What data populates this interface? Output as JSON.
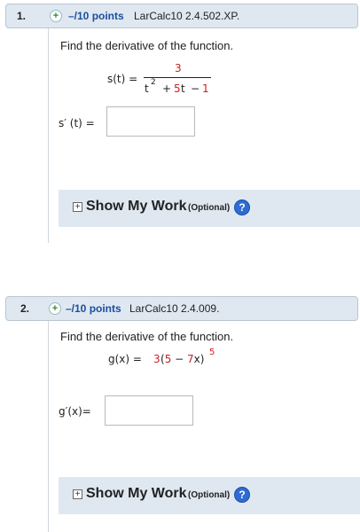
{
  "questions": [
    {
      "number": "1.",
      "points": "–/10 points",
      "source": "LarCalc10 2.4.502.XP.",
      "prompt": "Find the derivative of the function.",
      "func_lhs": "s(t) =",
      "numerator": "3",
      "den_t": "t",
      "den_exp": "2",
      "den_plus1": "+",
      "den_5t": "5t",
      "den_minus": "−",
      "den_1": "1",
      "answer_label": "s′ (t) =",
      "answer_value": "",
      "show_work": "Show My Work",
      "optional": "(Optional)",
      "help": "?"
    },
    {
      "number": "2.",
      "points": "–/10 points",
      "source": "LarCalc10 2.4.009.",
      "prompt": "Find the derivative of the function.",
      "func_lhs": "g(x) =",
      "func_3": "3",
      "func_paren": "(5 − 7x)",
      "func_exp": "5",
      "answer_label": "g′(x)=",
      "answer_value": "",
      "show_work": "Show My Work",
      "optional": "(Optional)",
      "help": "?"
    }
  ],
  "colors": {
    "header_bg": "#dfe8f1",
    "points": "#1a4fa0",
    "math_red": "#cc1f1f",
    "help_blue": "#2f6bd1"
  },
  "icons": {
    "expand": "plus-circle-icon",
    "show_work": "plus-square-icon",
    "help": "question-circle-icon"
  }
}
